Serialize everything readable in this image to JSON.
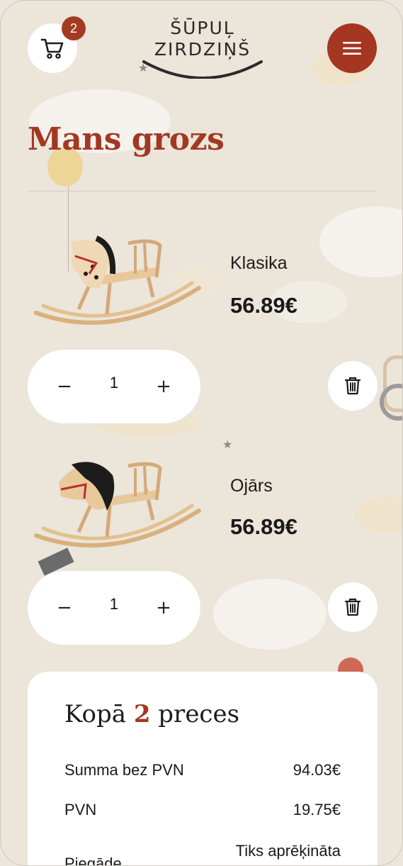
{
  "header": {
    "cart_count": "2",
    "logo_line1": "ŠŪPUĻ",
    "logo_line2": "ZIRDZIŅŠ"
  },
  "page": {
    "title": "Mans grozs"
  },
  "items": [
    {
      "name": "Klasika",
      "price": "56.89€",
      "quantity": "1",
      "minus": "−",
      "plus": "+"
    },
    {
      "name": "Ojārs",
      "price": "56.89€",
      "quantity": "1",
      "minus": "−",
      "plus": "+"
    }
  ],
  "summary": {
    "title_prefix": "Kopā",
    "count": "2",
    "title_suffix": "preces",
    "rows": [
      {
        "label": "Summa bez PVN",
        "value": "94.03€"
      },
      {
        "label": "PVN",
        "value": "19.75€"
      },
      {
        "label": "Piegāde",
        "value": "Tiks aprēķināta"
      }
    ]
  },
  "colors": {
    "accent": "#a33822",
    "background": "#ebe5da",
    "card": "#ffffff"
  },
  "icons": {
    "cart": "cart-icon",
    "menu": "menu-icon",
    "trash": "trash-icon"
  }
}
